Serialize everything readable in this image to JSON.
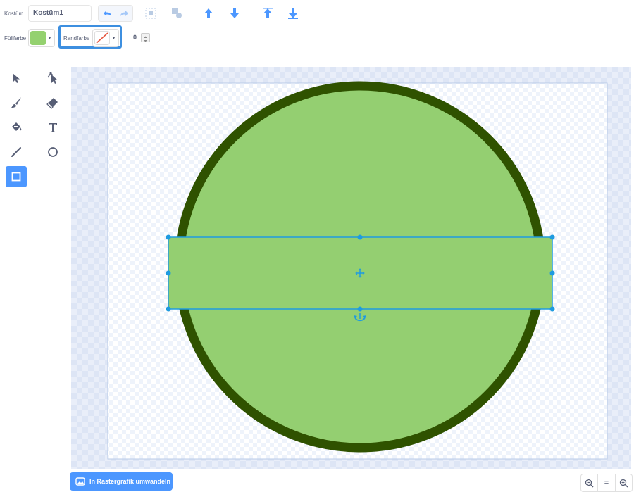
{
  "toolbar": {
    "costume_label": "Kostüm",
    "costume_name": "Kostüm1",
    "fill_label": "Füllfarbe",
    "outline_label": "Randfarbe",
    "outline_width": "0",
    "fill_color": "#94d16f",
    "outline_color": "none",
    "icons": [
      "undo-icon",
      "redo-icon",
      "group-icon",
      "ungroup-icon",
      "forward-icon",
      "backward-icon",
      "front-icon",
      "back-icon"
    ]
  },
  "tools": [
    "select-tool",
    "reshape-tool",
    "brush-tool",
    "eraser-tool",
    "fill-tool",
    "text-tool",
    "line-tool",
    "circle-tool",
    "rectangle-tool"
  ],
  "active_tool": "rectangle-tool",
  "canvas": {
    "circle_fill": "#94cf71",
    "circle_stroke": "#2f5200",
    "selection_color": "#1e9be0"
  },
  "bottom": {
    "convert_button": "In Rastergrafik umwandeln",
    "zoom_out": "−",
    "zoom_reset": "=",
    "zoom_in": "+"
  }
}
